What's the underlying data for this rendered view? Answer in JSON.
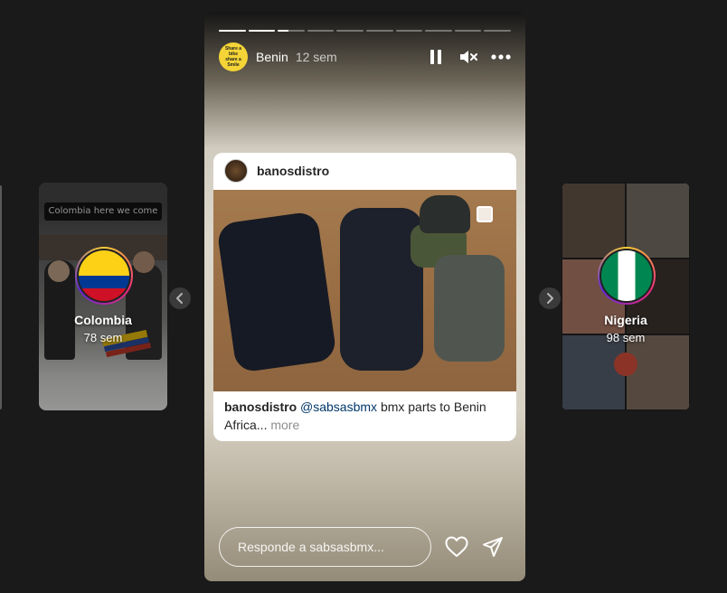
{
  "colors": {
    "background": "#1a1a1a",
    "progress_active": "#ffffff",
    "progress_inactive": "rgba(255,255,255,0.35)",
    "mention_link": "#00376b",
    "avatar_yellow": "#f4d436"
  },
  "left_preview": {
    "banner_text": "Colombia here we come",
    "name": "Colombia",
    "time": "78 sem",
    "flag": "colombia-flag"
  },
  "right_preview": {
    "name": "Nigeria",
    "time": "98 sem",
    "flag": "nigeria-flag"
  },
  "nav": {
    "prev_icon": "chevron-left-icon",
    "next_icon": "chevron-right-icon"
  },
  "story": {
    "progress": {
      "segment_count": 10,
      "fills": [
        1,
        1,
        0.4,
        0,
        0,
        0,
        0,
        0,
        0,
        0
      ]
    },
    "avatar_text": "Share a bike share a Smile",
    "username": "Benin",
    "time": "12 sem",
    "icons": [
      "pause-icon",
      "mute-icon",
      "more-options-icon"
    ],
    "post": {
      "username": "banosdistro",
      "caption_user": "banosdistro",
      "caption_mention": "@sabsasbmx",
      "caption_text": "bmx parts to Benin Africa",
      "caption_ellipsis": "...",
      "more_label": "more"
    },
    "reply": {
      "placeholder": "Responde a sabsasbmx..."
    },
    "like_icon": "heart-icon",
    "share_icon": "send-icon"
  }
}
